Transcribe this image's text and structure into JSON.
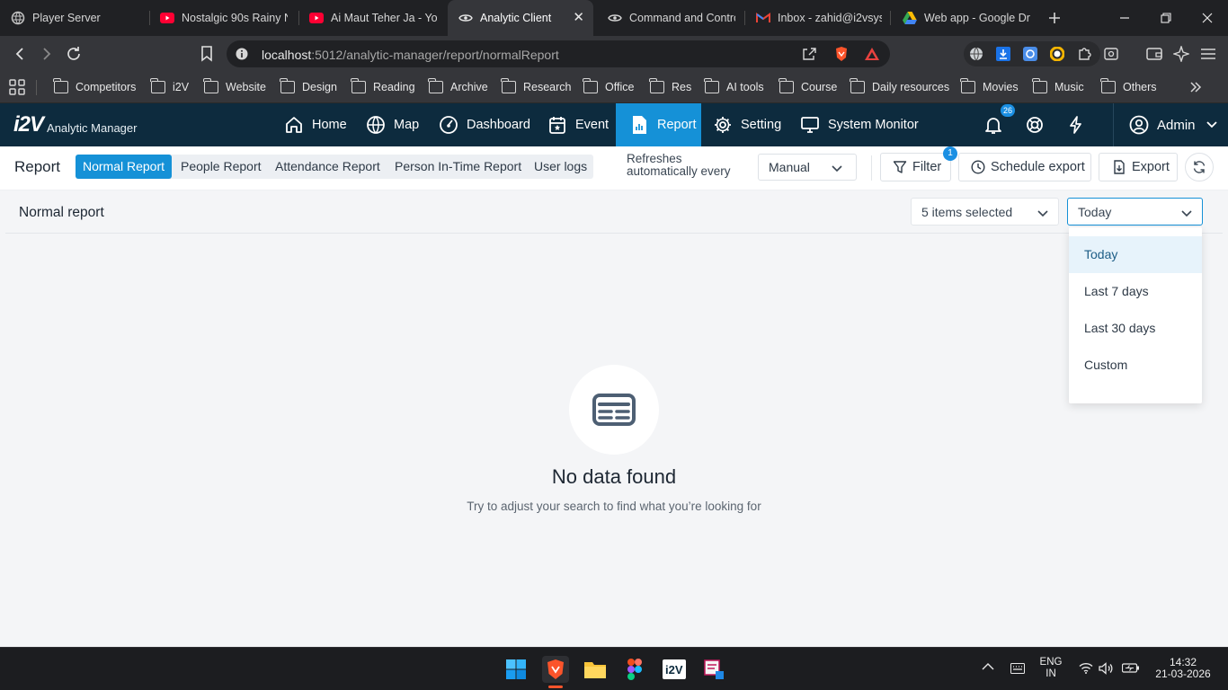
{
  "browser": {
    "tabs": [
      {
        "title": "Player Server",
        "active": false
      },
      {
        "title": "Nostalgic 90s Rainy N",
        "active": false
      },
      {
        "title": "Ai Maut Teher Ja - You",
        "active": false
      },
      {
        "title": "Analytic Client",
        "active": true
      },
      {
        "title": "Command and Contro",
        "active": false
      },
      {
        "title": "Inbox - zahid@i2vsys",
        "active": false
      },
      {
        "title": "Web app - Google Dr",
        "active": false
      }
    ],
    "url_host": "localhost",
    "url_path": ":5012/analytic-manager/report/normalReport",
    "bookmarks": [
      "Competitors",
      "i2V",
      "Website",
      "Design",
      "Reading",
      "Archive",
      "Research",
      "Office",
      "Res",
      "AI tools",
      "Course",
      "Daily resources",
      "Movies",
      "Music",
      "Others"
    ]
  },
  "app": {
    "logo_mark": "i2V",
    "name": "Analytic Manager",
    "nav": [
      {
        "label": "Home",
        "icon": "home-icon",
        "active": false
      },
      {
        "label": "Map",
        "icon": "globe-icon",
        "active": false
      },
      {
        "label": "Dashboard",
        "icon": "gauge-icon",
        "active": false
      },
      {
        "label": "Event",
        "icon": "calendar-icon",
        "active": false
      },
      {
        "label": "Report",
        "icon": "report-icon",
        "active": true
      },
      {
        "label": "Setting",
        "icon": "gear-icon",
        "active": false
      },
      {
        "label": "System Monitor",
        "icon": "monitor-icon",
        "active": false
      }
    ],
    "notifications_count": "26",
    "user": "Admin"
  },
  "report": {
    "title": "Report",
    "tabs": [
      {
        "label": "Normal Report",
        "active": true
      },
      {
        "label": "People Report",
        "active": false
      },
      {
        "label": "Attendance Report",
        "active": false
      },
      {
        "label": "Person In-Time Report",
        "active": false
      },
      {
        "label": "User logs",
        "active": false
      }
    ],
    "refresh_label_1": "Refreshes",
    "refresh_label_2": "automatically every",
    "refresh_value": "Manual",
    "filter_label": "Filter",
    "filter_badge": "1",
    "schedule_label": "Schedule export",
    "export_label": "Export"
  },
  "content": {
    "section_title": "Normal report",
    "items_selected": "5 items selected",
    "date_value": "Today",
    "date_options": [
      "Today",
      "Last 7 days",
      "Last 30 days",
      "Custom"
    ],
    "empty_title": "No data found",
    "empty_sub": "Try to adjust your search to find what you’re looking for"
  },
  "taskbar": {
    "lang_1": "ENG",
    "lang_2": "IN",
    "time": "14:32",
    "date": "21-03-2026",
    "pinned": [
      "windows-start",
      "brave-browser",
      "file-explorer",
      "figma",
      "i2v-app",
      "remote-app"
    ]
  },
  "colors": {
    "app_header": "#0d2b3e",
    "accent": "#1591d7",
    "content_bg": "#f4f5f7"
  }
}
